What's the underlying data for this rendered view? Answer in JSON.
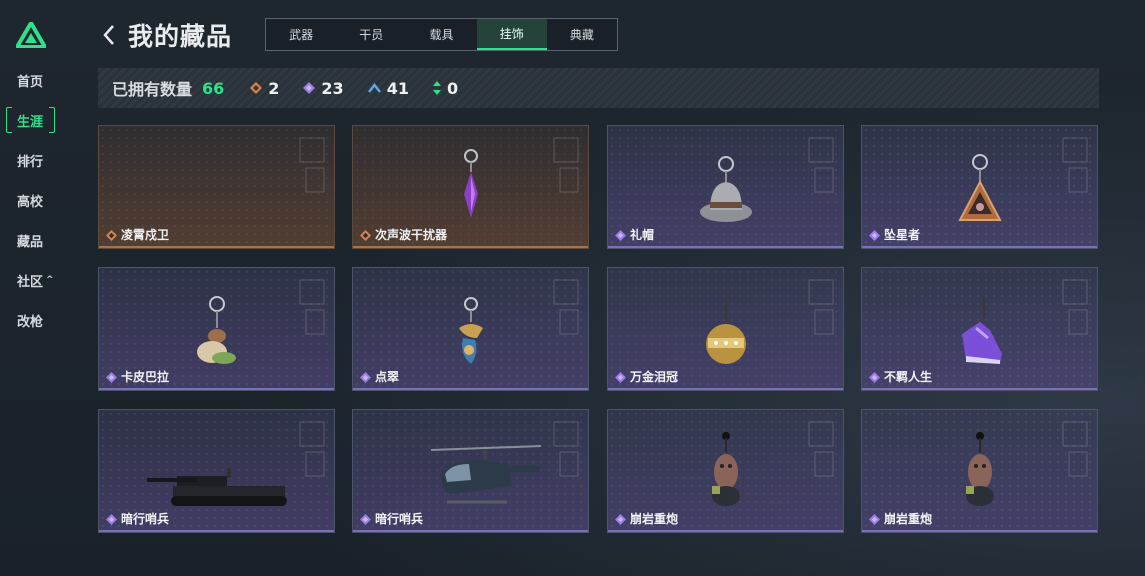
{
  "sidebar": {
    "items": [
      {
        "label": "首页",
        "active": false
      },
      {
        "label": "生涯",
        "active": true
      },
      {
        "label": "排行",
        "active": false
      },
      {
        "label": "高校",
        "active": false
      },
      {
        "label": "藏品",
        "active": false
      },
      {
        "label": "社区",
        "active": false,
        "has_caret": true
      },
      {
        "label": "改枪",
        "active": false
      }
    ],
    "caret": "^"
  },
  "header": {
    "title": "我的藏品",
    "back_icon": "chevron-left-icon"
  },
  "tabs": [
    {
      "label": "武器",
      "active": false
    },
    {
      "label": "干员",
      "active": false
    },
    {
      "label": "载具",
      "active": false
    },
    {
      "label": "挂饰",
      "active": true
    },
    {
      "label": "典藏",
      "active": false
    }
  ],
  "stats": {
    "label": "已拥有数量",
    "total": "66",
    "rarity_counts": [
      {
        "icon": "orange-diamond-icon",
        "value": "2",
        "color": "#d9844c"
      },
      {
        "icon": "purple-diamond-icon",
        "value": "23",
        "color": "#9d7ce8"
      },
      {
        "icon": "blue-chevron-icon",
        "value": "41",
        "color": "#5ea8e6"
      },
      {
        "icon": "green-arrows-icon",
        "value": "0",
        "color": "#2fe08c"
      }
    ]
  },
  "colors": {
    "accent": "#2fe08c",
    "orange": "#d9844c",
    "purple": "#9d7ce8"
  },
  "cards": [
    {
      "name": "凌霄戍卫",
      "rarity": "orange",
      "art": "none"
    },
    {
      "name": "次声波干扰器",
      "rarity": "orange",
      "art": "crystal"
    },
    {
      "name": "礼帽",
      "rarity": "purple",
      "art": "hat"
    },
    {
      "name": "坠星者",
      "rarity": "purple",
      "art": "triangle"
    },
    {
      "name": "卡皮巴拉",
      "rarity": "purple",
      "art": "capybara"
    },
    {
      "name": "点翠",
      "rarity": "purple",
      "art": "bird"
    },
    {
      "name": "万金泪冠",
      "rarity": "purple",
      "art": "crown"
    },
    {
      "name": "不羁人生",
      "rarity": "purple",
      "art": "sneaker"
    },
    {
      "name": "暗行哨兵",
      "rarity": "purple",
      "art": "tank"
    },
    {
      "name": "暗行哨兵",
      "rarity": "purple",
      "art": "helicopter"
    },
    {
      "name": "崩岩重炮",
      "rarity": "purple",
      "art": "figure"
    },
    {
      "name": "崩岩重炮",
      "rarity": "purple",
      "art": "figure"
    }
  ]
}
